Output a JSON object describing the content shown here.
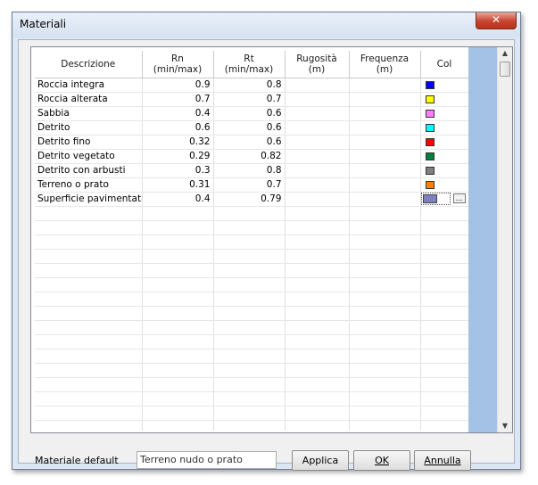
{
  "window": {
    "title": "Materiali",
    "close_glyph": "✕"
  },
  "table": {
    "headers": [
      {
        "l1": "Descrizione",
        "l2": ""
      },
      {
        "l1": "Rn",
        "l2": "(min/max)"
      },
      {
        "l1": "Rt",
        "l2": "(min/max)"
      },
      {
        "l1": "Rugosità",
        "l2": "(m)"
      },
      {
        "l1": "Frequenza",
        "l2": "(m)"
      },
      {
        "l1": "Col",
        "l2": ""
      }
    ],
    "rows": [
      {
        "desc": "Roccia integra",
        "rn": "0.9",
        "rt": "0.8",
        "color": "#0000ff"
      },
      {
        "desc": "Roccia alterata",
        "rn": "0.7",
        "rt": "0.7",
        "color": "#ffff00"
      },
      {
        "desc": "Sabbia",
        "rn": "0.4",
        "rt": "0.6",
        "color": "#ff80ff"
      },
      {
        "desc": "Detrito",
        "rn": "0.6",
        "rt": "0.6",
        "color": "#00ffff"
      },
      {
        "desc": "Detrito fino",
        "rn": "0.32",
        "rt": "0.6",
        "color": "#ff0000"
      },
      {
        "desc": "Detrito vegetato",
        "rn": "0.29",
        "rt": "0.82",
        "color": "#008040"
      },
      {
        "desc": "Detrito con arbusti",
        "rn": "0.3",
        "rt": "0.8",
        "color": "#808080"
      },
      {
        "desc": "Terreno o prato",
        "rn": "0.31",
        "rt": "0.7",
        "color": "#ff8000"
      },
      {
        "desc": "Superficie pavimentata",
        "rn": "0.4",
        "rt": "0.79",
        "color": "#8080c0",
        "selected": true
      }
    ],
    "color_picker_label": "..."
  },
  "footer": {
    "default_label": "Materiale default",
    "default_value": "Terreno nudo o prato",
    "apply_label": "Applica",
    "ok_label": "OK",
    "cancel_label": "Annulla"
  }
}
